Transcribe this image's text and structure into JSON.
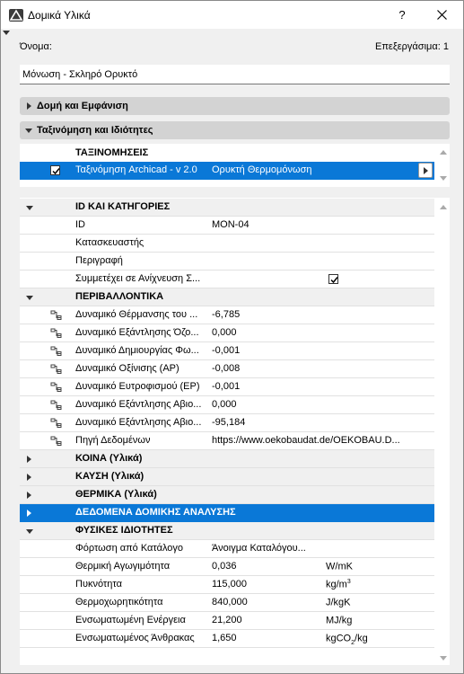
{
  "window": {
    "title": "Δομικά Υλικά",
    "help_label": "?",
    "close_label": "✕"
  },
  "header": {
    "name_label": "Όνομα:",
    "edit_label": "Επεξεργάσιμα: 1",
    "name_value": "Μόνωση - Σκληρό Ορυκτό"
  },
  "sections": {
    "structure": "Δομή και Εμφάνιση",
    "classification": "Ταξινόμηση και Ιδιότητες"
  },
  "classification": {
    "header": "ΤΑΞΙΝΟΜΗΣΕΙΣ",
    "system": "Ταξινόμηση Archicad - v 2.0",
    "value": "Ορυκτή Θερμομόνωση",
    "checked": true
  },
  "properties": {
    "id_group": {
      "title": "ID ΚΑΙ ΚΑΤΗΓΟΡΙΕΣ",
      "rows": [
        {
          "label": "ID",
          "value": "MON-04"
        },
        {
          "label": "Κατασκευαστής",
          "value": ""
        },
        {
          "label": "Περιγραφή",
          "value": ""
        },
        {
          "label": "Συμμετέχει σε Ανίχνευση Σ...",
          "value": "",
          "checked": true
        }
      ]
    },
    "env_group": {
      "title": "ΠΕΡΙΒΑΛΛΟΝΤΙΚΑ",
      "rows": [
        {
          "label": "Δυναμικό Θέρμανσης του ...",
          "value": "-6,785"
        },
        {
          "label": "Δυναμικό Εξάντλησης Όζο...",
          "value": "0,000"
        },
        {
          "label": "Δυναμικό Δημιουργίας Φω...",
          "value": "-0,001"
        },
        {
          "label": "Δυναμικό Οξίνισης (AP)",
          "value": "-0,008"
        },
        {
          "label": "Δυναμικό Ευτροφισμού (EP)",
          "value": "-0,001"
        },
        {
          "label": "Δυναμικό Εξάντλησης Αβιο...",
          "value": "0,000"
        },
        {
          "label": "Δυναμικό Εξάντλησης Αβιο...",
          "value": "-95,184"
        },
        {
          "label": "Πηγή Δεδομένων",
          "value": "https://www.oekobaudat.de/OEKOBAU.D..."
        }
      ]
    },
    "collapsed_groups": [
      "ΚΟΙΝΑ (Υλικά)",
      "ΚΑΥΣΗ (Υλικά)",
      "ΘΕΡΜΙΚΑ (Υλικά)",
      "ΔΕΔΟΜΕΝΑ ΔΟΜΙΚΗΣ ΑΝΑΛΥΣΗΣ"
    ],
    "phys_group": {
      "title": "ΦΥΣΙΚΕΣ ΙΔΙΟΤΗΤΕΣ",
      "rows": [
        {
          "label": "Φόρτωση από Κατάλογο",
          "value": "Άνοιγμα Καταλόγου...",
          "unit": "",
          "unit_sup": "",
          "unit_sub": "",
          "unit_tail": ""
        },
        {
          "label": "Θερμική Αγωγιμότητα",
          "value": "0,036",
          "unit": "W/mK",
          "unit_sup": "",
          "unit_sub": "",
          "unit_tail": ""
        },
        {
          "label": "Πυκνότητα",
          "value": "115,000",
          "unit": "kg/m",
          "unit_sup": "3",
          "unit_sub": "",
          "unit_tail": ""
        },
        {
          "label": "Θερμοχωρητικότητα",
          "value": "840,000",
          "unit": "J/kgK",
          "unit_sup": "",
          "unit_sub": "",
          "unit_tail": ""
        },
        {
          "label": "Ενσωματωμένη Ενέργεια",
          "value": "21,200",
          "unit": "MJ/kg",
          "unit_sup": "",
          "unit_sub": "",
          "unit_tail": ""
        },
        {
          "label": "Ενσωματωμένος Άνθρακας",
          "value": "1,650",
          "unit": "kgCO",
          "unit_sup": "",
          "unit_sub": "2",
          "unit_tail": "/kg"
        }
      ]
    }
  },
  "colors": {
    "selection": "#0a78d7",
    "section_bg": "#d3d3d3",
    "group_bg": "#f0f0f0"
  },
  "icons": {
    "app": "archicad-logo-icon",
    "row_link": "linked-property-icon",
    "expand": "triangle-right-icon",
    "collapse": "triangle-down-icon"
  }
}
